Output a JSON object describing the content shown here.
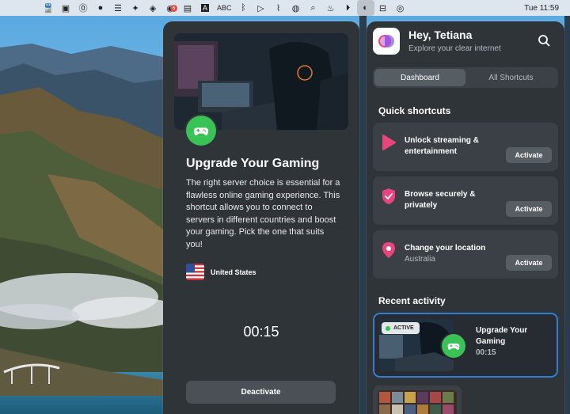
{
  "menubar": {
    "icons": [
      "train-icon",
      "display-icon",
      "circle-o-icon",
      "bowler-hat-icon",
      "list-icon",
      "dropbox-icon",
      "layers-icon",
      "notification-icon",
      "keyboard-icon",
      "input-source-icon",
      "bluetooth-icon",
      "play-icon",
      "wifi-icon",
      "user-icon",
      "search-icon",
      "flame-icon",
      "play-circle-icon",
      "clear-app-icon",
      "control-center-icon",
      "siri-icon"
    ],
    "notification_badge": "6",
    "input_letter": "A",
    "input_label": "ABC",
    "clock": "Tue 11:59"
  },
  "detail": {
    "title": "Upgrade Your Gaming",
    "description": "The right server choice is essential for a flawless online gaming experience. This shortcut allows you to connect to servers in different countries and boost your gaming. Pick the one that suits you!",
    "country": "United States",
    "timer": "00:15",
    "deactivate_label": "Deactivate"
  },
  "header": {
    "greeting": "Hey, Tetiana",
    "subtitle": "Explore your clear internet"
  },
  "tabs": [
    {
      "label": "Dashboard",
      "active": true
    },
    {
      "label": "All Shortcuts",
      "active": false
    }
  ],
  "quick_shortcuts": {
    "title": "Quick shortcuts",
    "items": [
      {
        "icon": "play-icon",
        "title": "Unlock streaming & entertainment",
        "subtitle": "",
        "button": "Activate"
      },
      {
        "icon": "shield-check-icon",
        "title": "Browse securely & privately",
        "subtitle": "",
        "button": "Activate"
      },
      {
        "icon": "location-pin-icon",
        "title": "Change your location",
        "subtitle": "Australia",
        "button": "Activate"
      }
    ]
  },
  "recent_activity": {
    "title": "Recent activity",
    "item": {
      "status": "ACTIVE",
      "title": "Upgrade Your Gaming",
      "time": "00:15"
    }
  },
  "colors": {
    "accent_pink": "#e9457a",
    "green": "#39c255",
    "selection_blue": "#2f7fd6"
  }
}
